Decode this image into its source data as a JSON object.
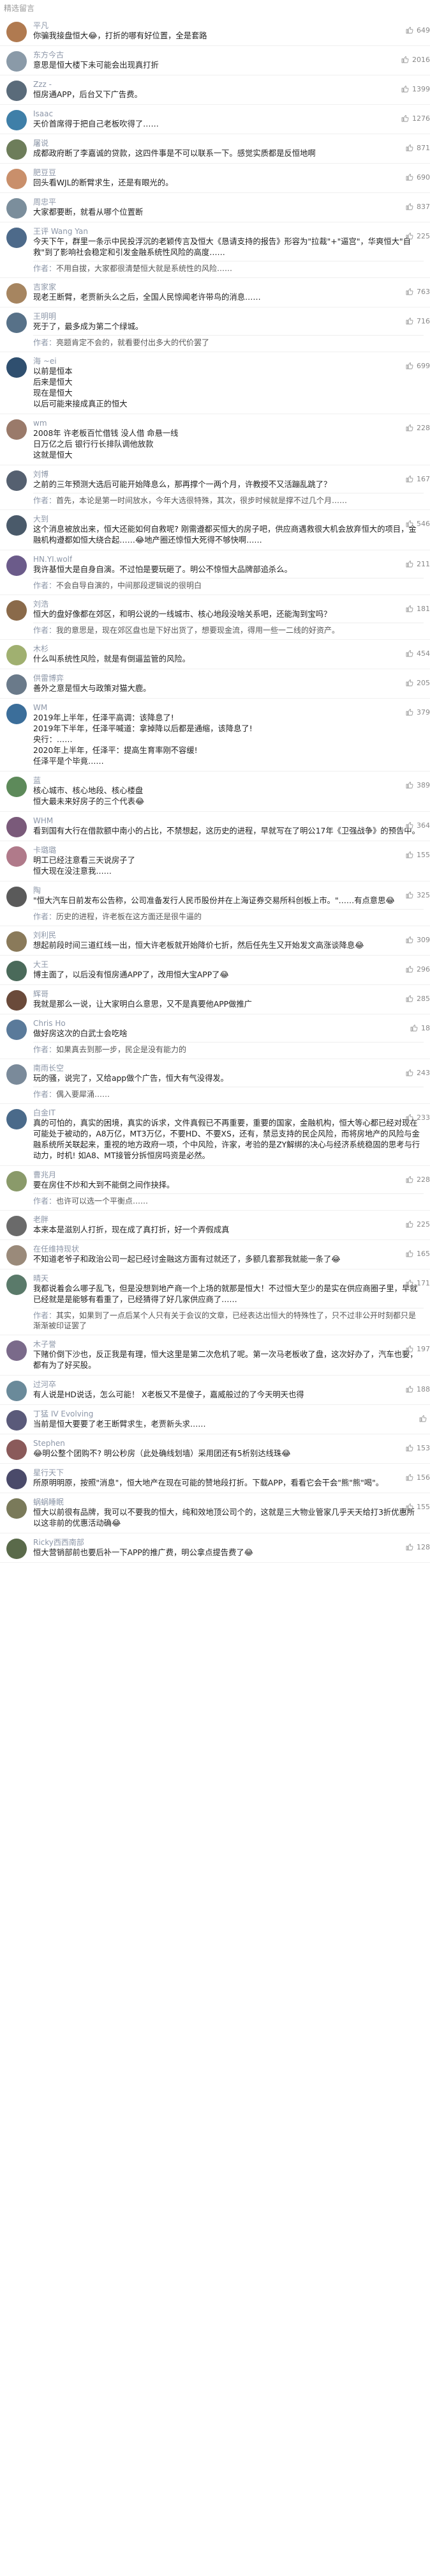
{
  "section_title": "精选留言",
  "comments": [
    {
      "user": "平凡",
      "likes": "649",
      "time": "",
      "content": "你骗我接盘恒大😂，打折的哪有好位置，全是套路",
      "replies": [],
      "avatar_color": "#b07a50"
    },
    {
      "user": "东方今古",
      "likes": "2016",
      "time": "",
      "content": "意思是恒大楼下未可能会出现真打折",
      "replies": [],
      "avatar_color": "#8a9aa8"
    },
    {
      "user": "Zzz -",
      "likes": "1399",
      "time": "",
      "content": "恒房通APP，后台又下广告费。",
      "replies": [],
      "avatar_color": "#5a6b7a"
    },
    {
      "user": "Isaac",
      "likes": "1276",
      "time": "",
      "content": "天价首席得于把自己老板吹得了……",
      "replies": [],
      "avatar_color": "#3f7fa8"
    },
    {
      "user": "屠说",
      "likes": "871",
      "time": "",
      "content": "成都政府断了李嘉诚的贷款，这四件事是不可以联系一下。感觉实质都是反恒地啊",
      "replies": [],
      "avatar_color": "#6d7d5a"
    },
    {
      "user": "肥豆豆",
      "likes": "690",
      "time": "",
      "content": "回头看WJL的断臂求生，还是有眼光的。",
      "replies": [],
      "avatar_color": "#c98f6b"
    },
    {
      "user": "周忠平",
      "likes": "837",
      "time": "",
      "content": "大家都要断，就看从哪个位置断",
      "replies": [],
      "avatar_color": "#7b8e9c"
    },
    {
      "user": "王评 Wang Yan",
      "likes": "225",
      "time": "",
      "content": "今天下午，群里一条示中民投浮沉的老颖传言及恒大《恳请支持的报告》形容为\"拉裁\"+\"逼宫\"，华爽恒大\"自救\"到了影响社会稳定和引发金融系统性风险的高度……",
      "replies": [
        {
          "author": "作者",
          "text": "不用自拔，大家都很清楚恒大就是系统性的风险……"
        }
      ],
      "avatar_color": "#4d6a8a"
    },
    {
      "user": "吉家家",
      "likes": "763",
      "time": "",
      "content": "现老王断臂，老贾新头么之后，全国人民惊闻老许带鸟的消息……",
      "replies": [],
      "avatar_color": "#a68560"
    },
    {
      "user": "王明明",
      "likes": "716",
      "time": "",
      "content": "死于了，最多成为第二个绿城。",
      "replies": [
        {
          "author": "作者",
          "text": "亮题肯定不会的，就看要付出多大的代价罢了"
        }
      ],
      "avatar_color": "#577188"
    },
    {
      "user": "海 ~ei",
      "likes": "699",
      "time": "",
      "content": "以前是恒本\n后来是恒大\n现在是恒大\n以后可能来接成真正的恒大",
      "replies": [],
      "avatar_color": "#2f4f6f"
    },
    {
      "user": "wm",
      "likes": "228",
      "time": "",
      "content": "2008年 许老板百忙借钱 没人借 命悬一线\n日万亿之后  银行行长排队调他放款\n这就是恒大",
      "replies": [],
      "avatar_color": "#9a7a6a"
    },
    {
      "user": "刘博",
      "likes": "167",
      "time": "",
      "content": "之前的三年预测大选后可能开始降息么，那再撑个一两个月，许教授不又活蹦乱跳了？",
      "replies": [
        {
          "author": "作者",
          "text": "首先，本论是第一时间放水，今年大选很特殊，其次，很步时候就是撑不过几个月……"
        }
      ],
      "avatar_color": "#556070"
    },
    {
      "user": "大到",
      "likes": "546",
      "time": "",
      "content": "这个消息被放出来，恒大还能如何自救呢? 刚需遵都买恒大的房子吧，供应商遇救很大机会放弃恒大的项目，金融机构遵都如恒大绕合起……😂地产圈还惊恒大死得不够快啊……",
      "replies": [],
      "avatar_color": "#4a5a6a"
    },
    {
      "user": "HN.YI.wolf",
      "likes": "211",
      "time": "",
      "content": "我许基恒大是自身自演。不过怕是要玩砸了。明公不惊恒大品牌部追杀么。",
      "replies": [
        {
          "author": "作者",
          "text": "不会自导自演的，中间那段逻辑说的很明白"
        }
      ],
      "avatar_color": "#6b5b8a"
    },
    {
      "user": "刘浩",
      "likes": "181",
      "time": "",
      "content": "恒大的盘好像都在郊区，和明公说的一线城市、核心地段没啥关系吧，还能淘到宝吗？",
      "replies": [
        {
          "author": "作者",
          "text": "我的意思是，现在郊区盘也是下好出货了，想要现金流，得用一些一二线的好资产。"
        }
      ],
      "avatar_color": "#8a6a4a"
    },
    {
      "user": "木杉",
      "likes": "454",
      "time": "",
      "content": "什么叫系统性风险，就是有倒逼监管的风险。",
      "replies": [],
      "avatar_color": "#a0b070"
    },
    {
      "user": "供雷博弈",
      "likes": "205",
      "time": "",
      "content": "善外之意是恒大与政策对猫大鹿。",
      "replies": [],
      "avatar_color": "#6a7a8a"
    },
    {
      "user": "WM",
      "likes": "379",
      "time": "",
      "content": "2019年上半年，任泽平高调：该降息了!\n2019年下半年，任泽平喊道：拿掉降以后都是通缩，该降息了!\n央行：……\n2020年上半年，任泽平：提高生育率刚不容缓!\n任泽平是个毕竟……",
      "replies": [],
      "avatar_color": "#3b6e9a"
    },
    {
      "user": "蓝",
      "likes": "389",
      "time": "",
      "content": "核心城市、核心地段、核心楼盘\n恒大最未来好房子的三个代表😂",
      "replies": [],
      "avatar_color": "#5d8a5a"
    },
    {
      "user": "WHM",
      "likes": "364",
      "time": "",
      "content": "看到国有大行在借款额中南小的占比，不禁想起，这历史的进程，早就写在了明公17年《卫强战争》的预告中。",
      "replies": [],
      "avatar_color": "#7a5a7a"
    },
    {
      "user": "卡璐璐",
      "likes": "155",
      "time": "",
      "content": "明工已经注意看三天说房子了\n恒大现在没注意我……",
      "replies": [],
      "avatar_color": "#b07a8a"
    },
    {
      "user": "陶",
      "likes": "325",
      "time": "",
      "content": "\"恒大汽车日前发布公告称，公司准备发行人民币股份并在上海证券交易所科创板上市。\"……有点意思😂",
      "replies": [
        {
          "author": "作者",
          "text": "历史的进程，许老板在这方面还是很牛逼的"
        }
      ],
      "avatar_color": "#5a5a5a"
    },
    {
      "user": "刘利民",
      "likes": "309",
      "time": "",
      "content": "想起前段时间三道红线一出，恒大许老板就开始降价七折，然后任先生又开始发文高涨谈降息😂",
      "replies": [],
      "avatar_color": "#8a7a5a"
    },
    {
      "user": "大王",
      "likes": "296",
      "time": "",
      "content": "博主面了，以后没有恒房通APP了，改用恒大宝APP了😂",
      "replies": [],
      "avatar_color": "#4a6a5a"
    },
    {
      "user": "辉哥",
      "likes": "285",
      "time": "",
      "content": "我就是那么一说，让大家明白么意思，又不是真要他APP做推广",
      "replies": [],
      "avatar_color": "#6a4a3a"
    },
    {
      "user": "Chris Ho",
      "likes": "18",
      "time": "",
      "content": "做好房这次的白武士会吃啥",
      "replies": [
        {
          "author": "作者",
          "text": "如果真去到那一步，民企是没有能力的"
        }
      ],
      "avatar_color": "#5a7a9a"
    },
    {
      "user": "南雨长空",
      "likes": "243",
      "time": "",
      "content": "玩的骚，说完了，又给app做个广告，恒大有气没得发。",
      "replies": [
        {
          "author": "作者",
          "text": "偶入要犀涌……"
        }
      ],
      "avatar_color": "#7a8a9a"
    },
    {
      "user": "白金IT",
      "likes": "233",
      "time": "",
      "content": "真的可怕的，真实的困境，真实的诉求，文件真假已不再重要，重要的国家，金融机构，恒大等心都已经对现在可能处于被动的，A8万亿，MT3万亿，不要HD、不要XS，还有，禁忌支持的民企风险，而将房地产的风险与金融系统所关联起来，重视的地方政府一项，个中风险，许家，考验的是ZY解绑的决心与经济系统稳固的思考与行动力，时机! 如A8、MT接管分拆恒房吗资是必然。",
      "replies": [],
      "avatar_color": "#4a6a8a"
    },
    {
      "user": "曹兆月",
      "likes": "228",
      "time": "",
      "content": "要在房住不炒和大到不能倒之间作抉择。",
      "replies": [
        {
          "author": "作者",
          "text": "也许可以选一个平衡点……"
        }
      ],
      "avatar_color": "#8a9a6a"
    },
    {
      "user": "老胖",
      "likes": "225",
      "time": "",
      "content": "本来本是滋别人打折，现在成了真打折，好一个弄假成真",
      "replies": [],
      "avatar_color": "#6a6a6a"
    },
    {
      "user": "在任维持现状",
      "likes": "165",
      "time": "",
      "content": "不知道老爷子和政治公司一起已经讨金融这方面有过就还了，多额几套那我就能一条了😂",
      "replies": [],
      "avatar_color": "#9a8a7a"
    },
    {
      "user": "晴天",
      "likes": "171",
      "time": "",
      "content": "我都说着会么哪子乱飞，但是没想到地产商一个上场的就那是恒大！不过恒大至少的是实在供应商圈子里，早就已经就是是能够有看重了，已经猜得了好几家供应商了……",
      "replies": [
        {
          "author": "作者",
          "text": "其实，如果到了一点后某个人只有关于会议的文章，已经表达出恒大的特殊性了，只不过非公开时刻都只是渐渐被印证罢了"
        }
      ],
      "avatar_color": "#5a7a6a"
    },
    {
      "user": "木子誉",
      "likes": "197",
      "time": "",
      "content": "下赌价倒下沙也，反正我是有理，恒大这里是第二次危机了呢。第一次马老板收了盘，这次好办了，汽车也要，都有为了好买股。",
      "replies": [],
      "avatar_color": "#7a6a8a"
    },
    {
      "user": "过河卒",
      "likes": "188",
      "time": "",
      "content": "有人说是HD说话，怎么可能！ X老板又不是傻子，嘉威般过的了今天明天也得",
      "replies": [],
      "avatar_color": "#6a8a9a"
    },
    {
      "user": "丁猛 IV Evolving",
      "likes": "",
      "time": "",
      "content": "当前是恒大要要了老王断臂求生，老贾新头求……",
      "replies": [],
      "avatar_color": "#5a5a7a"
    },
    {
      "user": "Stephen",
      "likes": "153",
      "time": "",
      "content": "😂明公整个团购不? 明公秒房（此处确线划墙）采用团还有5析别达线珠😂",
      "replies": [],
      "avatar_color": "#8a5a5a"
    },
    {
      "user": "星行天下",
      "likes": "156",
      "time": "",
      "content": "所原明明原，按照\"消息\"，恒大地产在现在可能的赞地段打折。下载APP，看看它会干会\"熊\"熊\"喝\"。",
      "replies": [],
      "avatar_color": "#4a4a6a"
    },
    {
      "user": "蜗蜗睡眠",
      "likes": "155",
      "time": "",
      "content": "恒大以前很有品牌，我可以不要我的恒大，纯和效地顶公司个的，这就是三大物业管家几乎天天给打3折优惠所以这非前的优惠活动确😂",
      "replies": [],
      "avatar_color": "#7a7a5a"
    },
    {
      "user": "Ricky西西南部",
      "likes": "128",
      "time": "",
      "content": "恒大营销部前也要后补一下APP的推广费，明公拿点提告费了😂",
      "replies": [],
      "avatar_color": "#5a6a4a"
    }
  ]
}
